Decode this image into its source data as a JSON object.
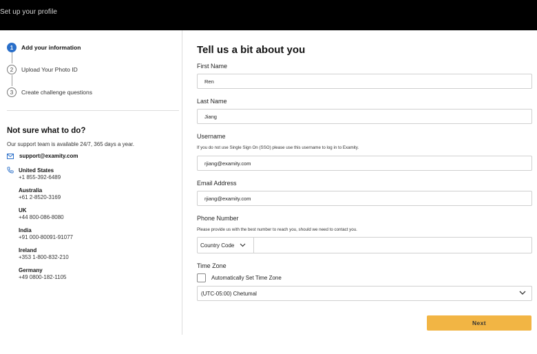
{
  "header": {
    "title": "Set up your profile"
  },
  "steps": [
    {
      "number": "1",
      "label": "Add your information",
      "active": true
    },
    {
      "number": "2",
      "label": "Upload Your Photo ID",
      "active": false
    },
    {
      "number": "3",
      "label": "Create challenge questions",
      "active": false
    }
  ],
  "help": {
    "title": "Not sure what to do?",
    "subtitle": "Our support team is available 24/7, 365 days a year.",
    "email": "support@examity.com",
    "contacts": [
      {
        "country": "United States",
        "phone": "+1 855-392-6489"
      },
      {
        "country": "Australia",
        "phone": "+61 2-8520-3169"
      },
      {
        "country": "UK",
        "phone": "+44 800-086-8080"
      },
      {
        "country": "India",
        "phone": "+91 000-80091-91077"
      },
      {
        "country": "Ireland",
        "phone": "+353 1-800-832-210"
      },
      {
        "country": "Germany",
        "phone": "+49 0800-182-1105"
      }
    ]
  },
  "form": {
    "heading": "Tell us a bit about you",
    "first_name": {
      "label": "First Name",
      "value": "Ren"
    },
    "last_name": {
      "label": "Last Name",
      "value": "Jiang"
    },
    "username": {
      "label": "Username",
      "hint": "If you do not use Single Sign On (SSO) please use this username to log in to Examity.",
      "value": "rjiang@examity.com"
    },
    "email": {
      "label": "Email Address",
      "value": "rjiang@examity.com"
    },
    "phone": {
      "label": "Phone Number",
      "hint": "Please provide us with the best number to reach you, should we need to contact you.",
      "country_code_label": "Country Code",
      "value": ""
    },
    "timezone": {
      "label": "Time Zone",
      "auto_label": "Automatically Set Time Zone",
      "auto_checked": false,
      "selected": "(UTC-05:00) Chetumal"
    },
    "next_label": "Next"
  },
  "colors": {
    "header_bg": "#000000",
    "active_step": "#2a6fc9",
    "next_button": "#f2b544"
  },
  "icons": {
    "email": "envelope-icon",
    "phone": "phone-icon",
    "dropdown": "chevron-down-icon"
  }
}
